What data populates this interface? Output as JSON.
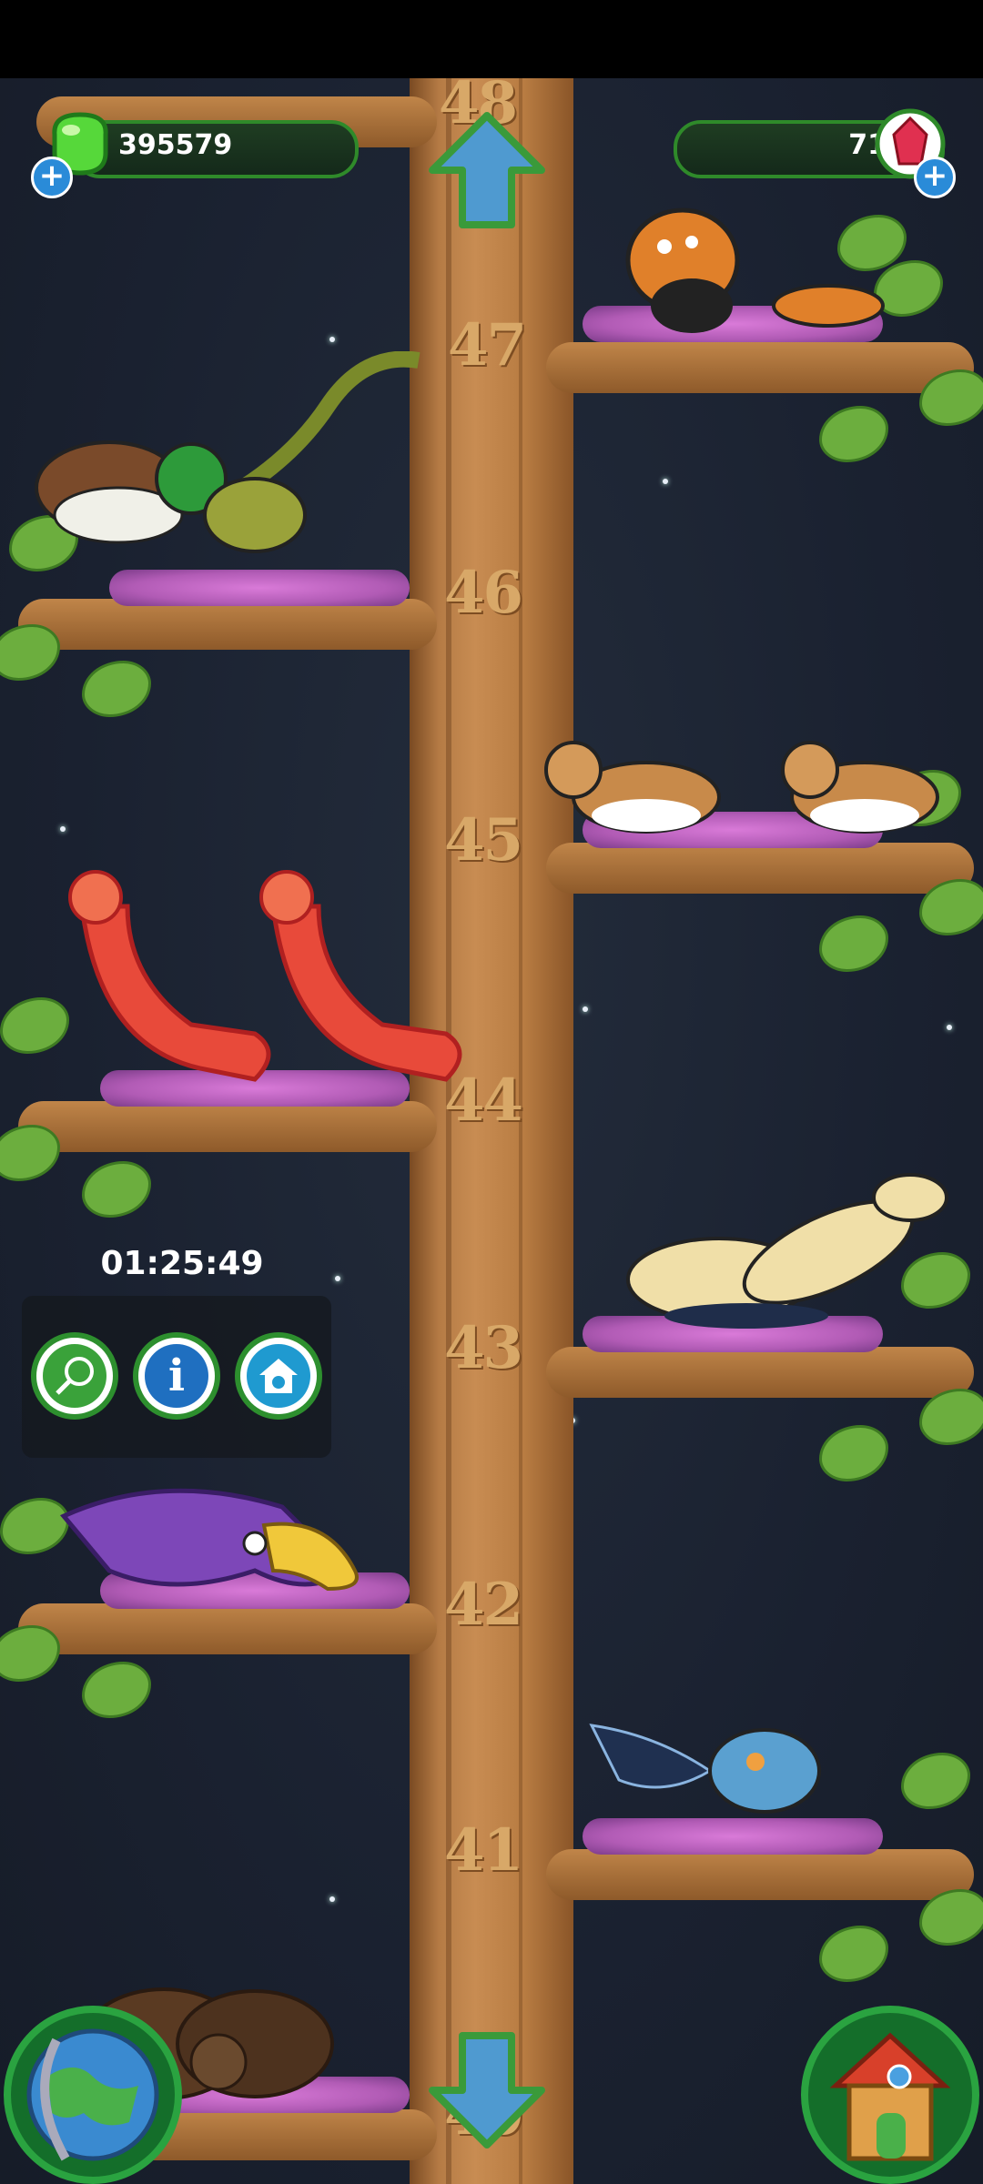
{
  "resources": {
    "coins": "395579",
    "gems": "71"
  },
  "floors": [
    {
      "number": "48"
    },
    {
      "number": "47",
      "animal": "butterfly-orange"
    },
    {
      "number": "46",
      "animal": "duck-and-raptor"
    },
    {
      "number": "45",
      "animal": "corgi"
    },
    {
      "number": "44",
      "animal": "lobster"
    },
    {
      "number": "43",
      "animal": "camel-platypus"
    },
    {
      "number": "42",
      "animal": "purple-manta"
    },
    {
      "number": "41",
      "animal": "butterfly-blue"
    },
    {
      "number": "40",
      "animal": "wombat"
    }
  ],
  "popup": {
    "timer": "01:25:49",
    "buttons": [
      "net-icon",
      "info-icon",
      "shelter-icon"
    ]
  },
  "icons": {
    "coin": "green-gem-icon",
    "gem": "red-crystal-icon",
    "up": "up-arrow-icon",
    "down": "down-arrow-icon",
    "globe": "globe-icon",
    "home": "house-icon"
  },
  "colors": {
    "accent_green": "#2f8a2a",
    "sky": "#1b2230",
    "trunk": "#c88c52",
    "info_blue": "#2a8bd8"
  }
}
